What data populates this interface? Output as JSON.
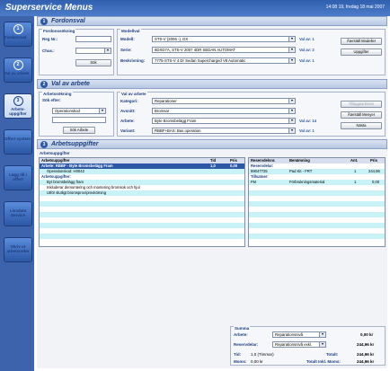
{
  "app": {
    "title": "Superservice Menus",
    "date_text": "14:08 19, fredag 18 mai 2007"
  },
  "sidebar": {
    "items": [
      {
        "num": "1",
        "label": "Fordonsval",
        "active": true
      },
      {
        "num": "2",
        "label": "Val av arbete",
        "active": false
      },
      {
        "num": "3",
        "label": "Arbets-uppgifter",
        "active": true
      },
      {
        "num": "",
        "label": "Offert system",
        "active": false
      },
      {
        "num": "",
        "label": "Lägg till i offert",
        "active": false
      },
      {
        "num": "",
        "label": "Livsdata Service",
        "active": false
      },
      {
        "num": "",
        "label": "Skriv ut arbetsorder",
        "active": false
      }
    ]
  },
  "section1": {
    "num": "1",
    "title": "Fordonsval",
    "search_group": "Fordonssökning",
    "reg_label": "Reg Nr.:",
    "reg_value": "",
    "chassi_label": "Chas.:",
    "chassi_value": "",
    "sok_label": "Sök",
    "model_group": "Modellval",
    "modell_label": "Modell:",
    "modell_value": "STS-V (2006 -), DX",
    "serie_label": "Serie:",
    "serie_value": "6DXD7A, STS-V 2007 4DR SEDAN AUTOMAT",
    "beskr_label": "Beskrivning:",
    "beskr_value": "7775-STS-V 4 Dr Sedan Supercharged V8 Automatic",
    "valnr1": "Val av: 1",
    "valnr2": "Val av: 2",
    "valnr3": "Val av: 1",
    "reset_label": "Återställ Modeller",
    "info_label": "Uppgifter"
  },
  "section2": {
    "num": "2",
    "title": "Val av arbete",
    "work_group": "Arbetssökning",
    "sokefter_label": "Sök efter:",
    "select_value": "Operationskod",
    "sokarbete_label": "Sök Arbete",
    "choice_group": "Val av arbete",
    "kategori_label": "Kategori:",
    "kategori_value": "Reparationer",
    "avsnitt_label": "Avsnitt:",
    "avsnitt_value": "Bromsar",
    "arbete_label": "Arbete:",
    "arbete_value": "Byte Bromsbelägg Fram",
    "variant_label": "Variant:",
    "variant_value": "RBBF+BAS: Bas operation",
    "valnr_arbete": "Val av: 14",
    "valnr_variant": "Val av: 1",
    "tillagg_label": "Tilläggsarbeten",
    "reset_label": "Återställ Menyer",
    "next_label": "Nästa"
  },
  "section3": {
    "num": "3",
    "title": "Arbetsuppgifter",
    "left_table": {
      "group": "Arbetsuppgifter",
      "headers": [
        "Arbetsuppgifter",
        "Tid",
        "Pris"
      ],
      "rows": [
        {
          "text": "Arbete: RBBF - Byte Bromsbelägg Fram",
          "tid": "1,0",
          "pris": "0,00",
          "style": "sel"
        },
        {
          "text": "Operationskod: H0042",
          "tid": "",
          "pris": "",
          "style": "cyan"
        },
        {
          "text": "Arbetsuppgifter:",
          "tid": "",
          "pris": "",
          "style": "sub"
        },
        {
          "text": "Byt bromsbelägg fram",
          "tid": "",
          "pris": "",
          "style": "cyan"
        },
        {
          "text": "Inkluderar demontering och montering bromsok och hjul",
          "tid": "",
          "pris": "",
          "style": ""
        },
        {
          "text": "Utför slutligt bromsprov/provkörning",
          "tid": "",
          "pris": "",
          "style": "cyan"
        }
      ]
    },
    "right_table": {
      "headers": [
        "Reservdelsnr.",
        "Benämning",
        "Ant.",
        "Pris"
      ],
      "rows": [
        {
          "nr": "Reservdelar:",
          "ben": "",
          "ant": "",
          "pris": "",
          "style": "sub"
        },
        {
          "nr": "89047725",
          "ben": "Pad Kit - FRT",
          "ant": "1",
          "pris": "244,96",
          "style": "cyan"
        },
        {
          "nr": "Tillsatser:",
          "ben": "",
          "ant": "",
          "pris": "",
          "style": "sub"
        },
        {
          "nr": "FM",
          "ben": "Förbrukningsmaterial",
          "ant": "1",
          "pris": "0,00",
          "style": "cyan"
        }
      ]
    }
  },
  "summa": {
    "title": "Summa",
    "arbete_label": "Arbete:",
    "arbete_sel": "Reparationsnivå",
    "arbete_total": "0,00 kr",
    "res_label": "Reservdelar:",
    "res_sel": "Reparationsnivå exkl.",
    "res_total": "244,96 kr",
    "tid_label": "Tid:",
    "tid_value": "1,0 (Timmar)",
    "moms_label": "Moms:",
    "moms_value": "0,00 kr",
    "totalt_label": "Totalt:",
    "totalt_value": "244,96 kr",
    "inkl_label": "Totalt Inkl. Moms:",
    "inkl_value": "244,96 kr"
  }
}
